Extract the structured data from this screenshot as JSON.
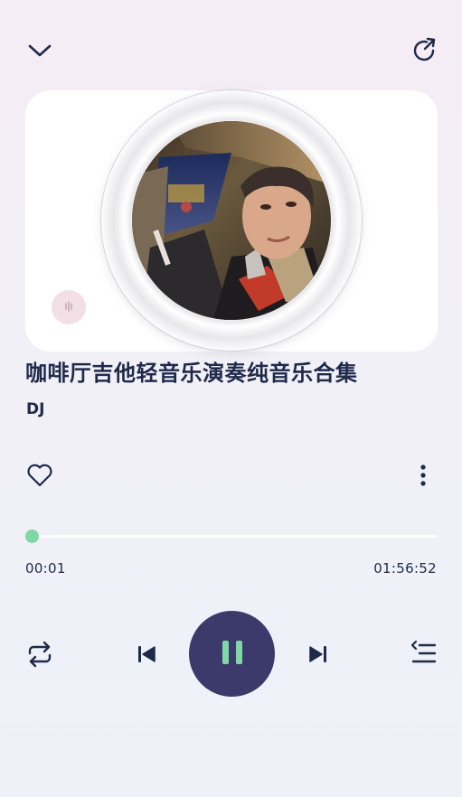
{
  "header": {
    "collapse_icon": "chevron-down-icon",
    "share_icon": "share-rotate-icon"
  },
  "album": {
    "cover_icon": "album-cover-photo",
    "badge_icon": "audio-wave-icon"
  },
  "song": {
    "title": "咖啡厅吉他轻音乐演奏纯音乐合集",
    "artist": "DJ"
  },
  "actions": {
    "like_icon": "heart-outline-icon",
    "more_icon": "more-vertical-icon"
  },
  "progress": {
    "current_time": "00:01",
    "total_time": "01:56:52",
    "fraction": 0.0001
  },
  "controls": {
    "repeat_icon": "repeat-icon",
    "prev_icon": "previous-track-icon",
    "play_state_icon": "pause-icon",
    "next_icon": "next-track-icon",
    "playlist_icon": "playlist-icon"
  },
  "colors": {
    "accent": "#7fd8a4",
    "primary_text": "#1f2a4a",
    "play_button": "#3c3a6b"
  }
}
